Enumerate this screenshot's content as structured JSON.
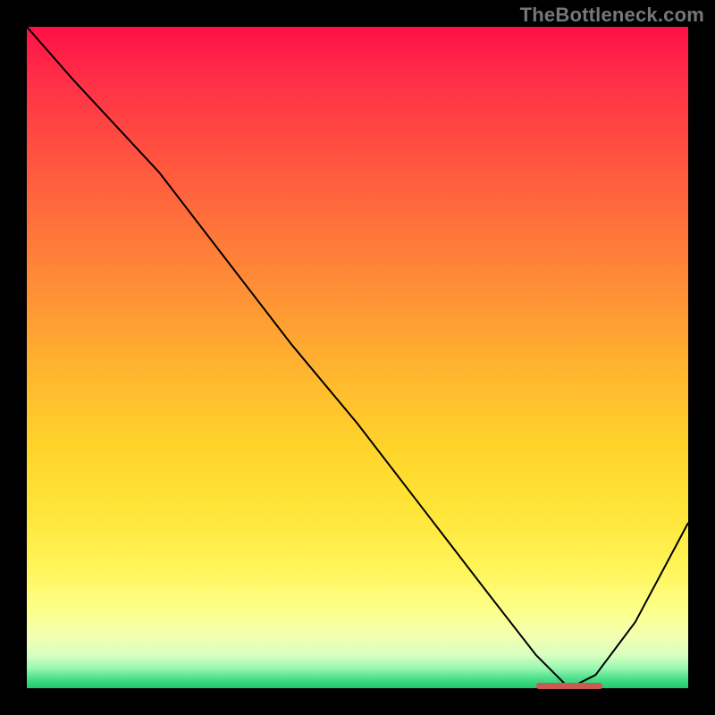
{
  "attribution": "TheBottleneck.com",
  "colors": {
    "gradient_top": "#ff1048",
    "gradient_bottom": "#1fc96e",
    "curve": "#000000",
    "marker": "#cc5a52",
    "background": "#000000",
    "attribution_text": "#777777"
  },
  "chart_data": {
    "type": "line",
    "title": "",
    "xlabel": "",
    "ylabel": "",
    "xlim": [
      0,
      100
    ],
    "ylim": [
      0,
      100
    ],
    "grid": false,
    "description": "Bottleneck mismatch curve. Y = mismatch percentage (high = red = severe bottleneck, low = green = balanced). X = relative component capability. Curve descends from top-left, reaches zero near x≈82 (optimal pairing), then rises toward the right edge.",
    "series": [
      {
        "name": "bottleneck-curve",
        "x": [
          0,
          7,
          20,
          30,
          40,
          50,
          60,
          70,
          77,
          82,
          86,
          92,
          100
        ],
        "values": [
          100,
          92,
          78,
          65,
          52,
          40,
          27,
          14,
          5,
          0,
          2,
          10,
          25
        ]
      }
    ],
    "optimal_zone": {
      "x_start": 77,
      "x_end": 87,
      "y": 0
    },
    "annotations": []
  }
}
